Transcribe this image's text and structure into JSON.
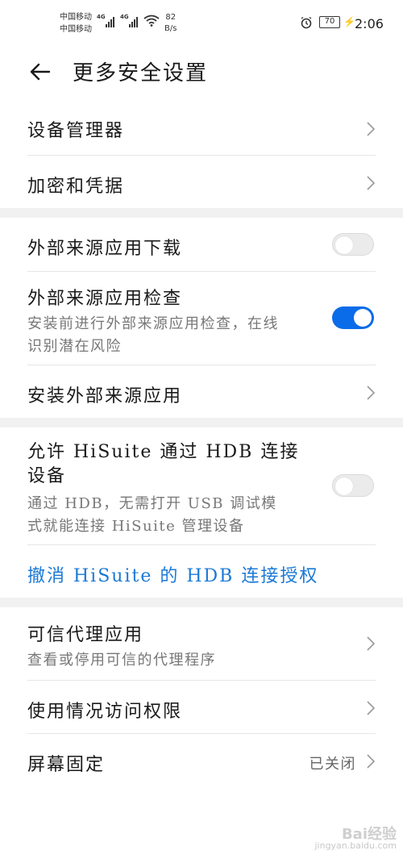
{
  "status_bar": {
    "carrier_1": "中国移动",
    "carrier_2": "中国移动",
    "network_1": "4G",
    "network_2": "4G",
    "speed_value": "82",
    "speed_unit": "B/s",
    "battery": "70",
    "time": "2:06"
  },
  "header": {
    "title": "更多安全设置"
  },
  "items": {
    "device_manager": "设备管理器",
    "encryption": "加密和凭据",
    "external_download": "外部来源应用下载",
    "external_download_on": false,
    "external_check": "外部来源应用检查",
    "external_check_desc_1": "安装前进行外部来源应用检查，在线",
    "external_check_desc_2": "识别潜在风险",
    "external_check_on": true,
    "install_external": "安装外部来源应用",
    "hisuite_1": "允许 HiSuite 通过 HDB 连接",
    "hisuite_2": "设备",
    "hisuite_desc_1": "通过 HDB，无需打开 USB 调试模",
    "hisuite_desc_2": "式就能连接 HiSuite 管理设备",
    "hisuite_on": false,
    "revoke_hdb": "撤消 HiSuite 的 HDB 连接授权",
    "trusted_agents": "可信代理应用",
    "trusted_agents_desc": "查看或停用可信的代理程序",
    "usage_access": "使用情况访问权限",
    "screen_pinning": "屏幕固定",
    "screen_pinning_value": "已关闭"
  },
  "watermark": {
    "logo": "Bai经验",
    "url": "jingyan.baidu.com"
  },
  "colors": {
    "accent": "#0a6ce8",
    "link": "#1a79d6",
    "section_gap": "#f1f1f1"
  }
}
